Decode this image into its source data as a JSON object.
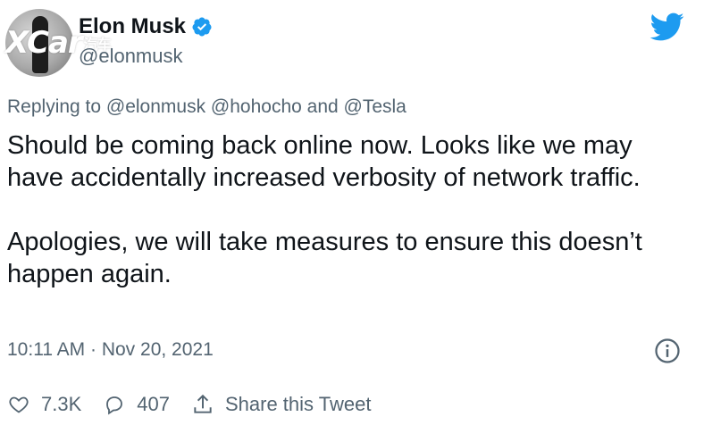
{
  "author": {
    "display_name": "Elon Musk",
    "handle": "@elonmusk",
    "verified": true
  },
  "watermark": {
    "main": "XCar",
    "small": "汽车"
  },
  "reply": {
    "text": "Replying to @elonmusk @hohocho and @Tesla"
  },
  "tweet": {
    "text": "Should be coming back online now. Looks like we may have accidentally increased verbosity of network traffic.\n\nApologies, we will take measures to ensure this doesn’t happen again.",
    "timestamp": "10:11 AM · Nov 20, 2021"
  },
  "actions": {
    "like_count": "7.3K",
    "reply_count": "407",
    "share_label": "Share this Tweet"
  },
  "colors": {
    "brand": "#1d9bf0",
    "text": "#0f1419",
    "secondary": "#536471"
  },
  "icons": [
    "verified-badge-icon",
    "twitter-bird-icon",
    "info-icon",
    "heart-icon",
    "reply-bubble-icon",
    "share-icon"
  ]
}
